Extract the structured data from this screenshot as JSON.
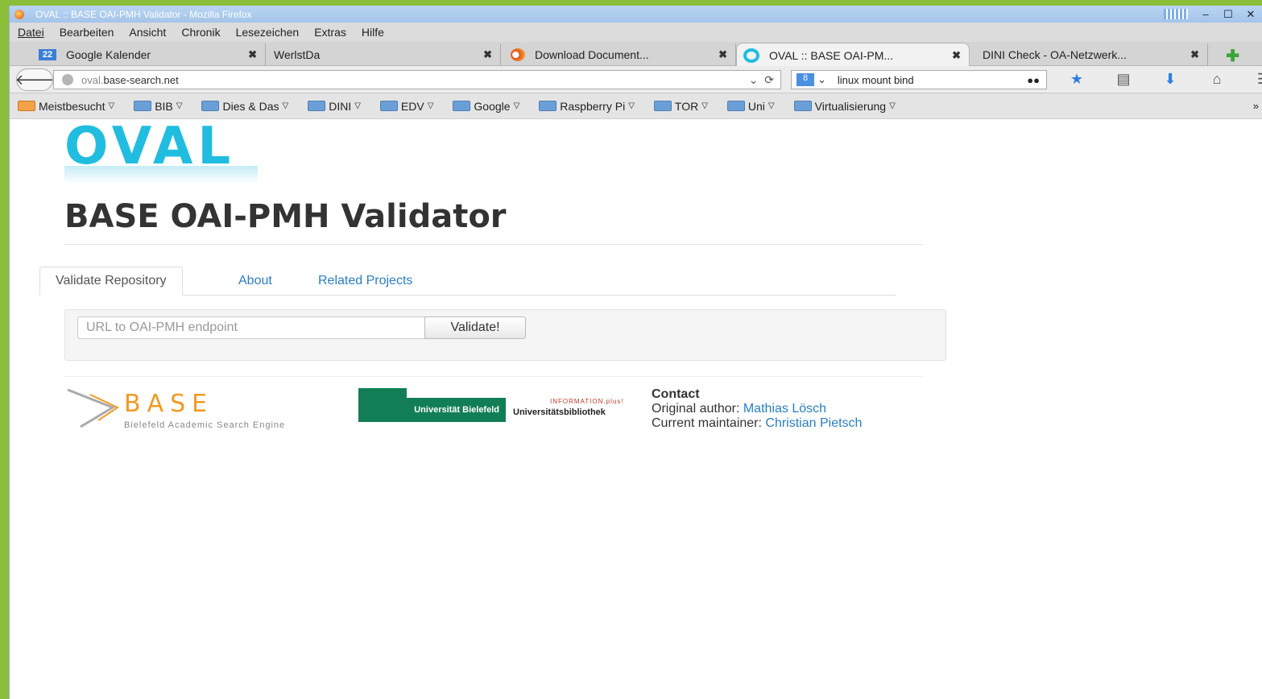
{
  "window": {
    "title": "OVAL :: BASE OAI-PMH Validator - Mozilla Firefox"
  },
  "menu": [
    "Datei",
    "Bearbeiten",
    "Ansicht",
    "Chronik",
    "Lesezeichen",
    "Extras",
    "Hilfe"
  ],
  "tabs": [
    {
      "label": "Google Kalender",
      "icon_text": "22"
    },
    {
      "label": "WerlstDa"
    },
    {
      "label": "Download Document..."
    },
    {
      "label": "OVAL :: BASE OAI-PM..."
    },
    {
      "label": "DINI Check - OA-Netzwerk..."
    }
  ],
  "nav": {
    "url_gray": "oval.",
    "url_main": "base-search.net",
    "search_value": "linux mount bind",
    "search_engine": "8"
  },
  "bookmarks": [
    "Meistbesucht",
    "BIB",
    "Dies & Das",
    "DINI",
    "EDV",
    "Google",
    "Raspberry Pi",
    "TOR",
    "Uni",
    "Virtualisierung"
  ],
  "page": {
    "logo": "OVAL",
    "heading": "BASE OAI-PMH Validator",
    "tabs": [
      "Validate Repository",
      "About",
      "Related Projects"
    ],
    "url_placeholder": "URL to OAI-PMH endpoint",
    "validate_label": "Validate!",
    "base_logo": "BASE",
    "base_subtitle": "Bielefeld Academic Search Engine",
    "uni_name": "Universität Bielefeld",
    "ub_name": "Universitätsbibliothek",
    "ub_tagline": "INFORMATION.plus!",
    "contact": {
      "title": "Contact",
      "author_label": "Original author: ",
      "author_name": "Mathias Lösch",
      "maintainer_label": "Current maintainer: ",
      "maintainer_name": "Christian Pietsch"
    }
  },
  "colors": {
    "accent": "#21bde0",
    "link": "#2a7ec3",
    "base_orange": "#f29a22",
    "uni_green": "#127e56"
  }
}
